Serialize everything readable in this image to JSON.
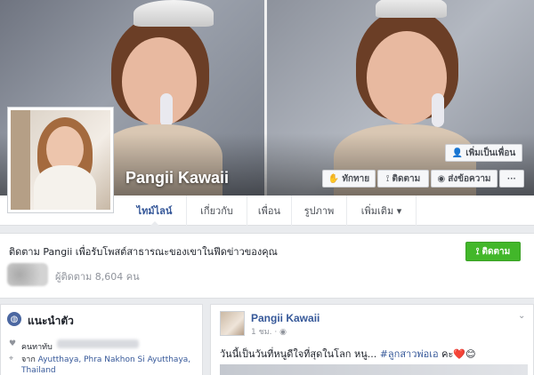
{
  "profile": {
    "name": "Pangii Kawaii"
  },
  "cover_buttons": {
    "add_friend": "เพิ่มเป็นเพื่อน",
    "greet": "ทักทาย",
    "follow": "ติดตาม",
    "message": "ส่งข้อความ",
    "more": "···"
  },
  "tabs": [
    {
      "label": "ไทม์ไลน์",
      "active": true
    },
    {
      "label": "เกี่ยวกับ",
      "active": false
    },
    {
      "label": "เพื่อน",
      "active": false
    },
    {
      "label": "รูปภาพ",
      "active": false
    },
    {
      "label": "เพิ่มเติม ▾",
      "active": false
    }
  ],
  "follow_card": {
    "text": "ติดตาม Pangii เพื่อรับโพสต์สาธารณะของเขาในฟีดข่าวของคุณ",
    "button": "ติดตาม",
    "followers": "ผู้ติดตาม 8,604 คน"
  },
  "intro": {
    "title": "แนะนำตัว",
    "known_label": "คนทาทับ",
    "from_prefix": "จาก",
    "from_location": "Ayutthaya, Phra Nakhon Si Ayutthaya, Thailand"
  },
  "post": {
    "author": "Pangii Kawaii",
    "time": "1 ชม. · ◉",
    "text_prefix": "วันนี้เป็นวันที่หนูดีใจที่สุดในโลก หนู... ",
    "hashtag": "#ลูกสาวพ่อเอ",
    "text_suffix": " คะ❤️😊"
  },
  "colors": {
    "fb_blue": "#365899",
    "follow_green": "#42b72a",
    "page_bg": "#e9ebee"
  }
}
